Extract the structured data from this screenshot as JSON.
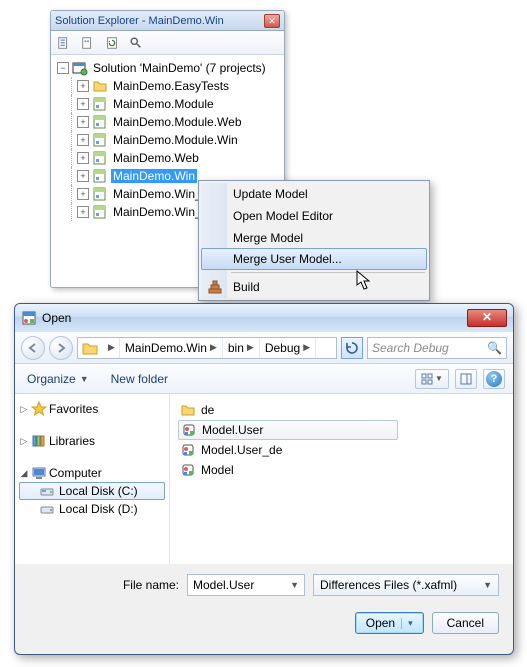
{
  "solution_explorer": {
    "title": "Solution Explorer - MainDemo.Win",
    "root": "Solution 'MainDemo' (7 projects)",
    "projects": [
      "MainDemo.EasyTests",
      "MainDemo.Module",
      "MainDemo.Module.Web",
      "MainDemo.Module.Win",
      "MainDemo.Web",
      "MainDemo.Win",
      "MainDemo.Win_ru",
      "MainDemo.Win_XamlOnly"
    ],
    "selected_index": 5
  },
  "context_menu": {
    "items": [
      "Update Model",
      "Open Model Editor",
      "Merge Model",
      "Merge User Model...",
      "Build"
    ],
    "highlighted_index": 3
  },
  "open_dialog": {
    "title": "Open",
    "breadcrumb": [
      "MainDemo.Win",
      "bin",
      "Debug"
    ],
    "search_placeholder": "Search Debug",
    "toolbar": {
      "organize": "Organize",
      "new_folder": "New folder"
    },
    "sidebar": {
      "favorites": "Favorites",
      "libraries": "Libraries",
      "computer": "Computer",
      "drives": [
        "Local Disk (C:)",
        "Local Disk (D:)"
      ],
      "selected_drive_index": 0
    },
    "files": [
      {
        "name": "de",
        "type": "folder"
      },
      {
        "name": "Model.User",
        "type": "xafml"
      },
      {
        "name": "Model.User_de",
        "type": "xafml"
      },
      {
        "name": "Model",
        "type": "xafml"
      }
    ],
    "selected_file_index": 1,
    "filename_label": "File name:",
    "filename_value": "Model.User",
    "filetype": "Differences Files (*.xafml)",
    "open_btn": "Open",
    "cancel_btn": "Cancel"
  }
}
